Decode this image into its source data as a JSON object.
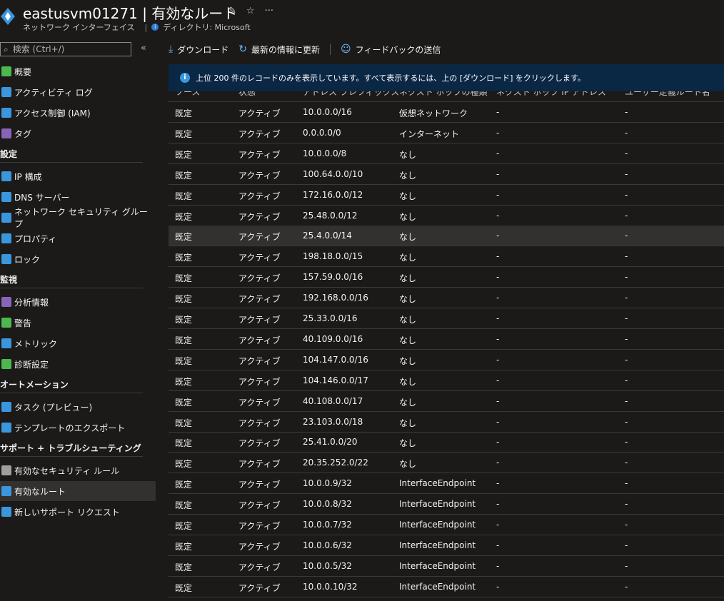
{
  "header": {
    "title": "eastusvm01271 | 有効なルート",
    "subtitle": "ネットワーク インターフェイス",
    "directory": "ディレクトリ: Microsoft",
    "actions": [
      "✩",
      "☆",
      "···"
    ]
  },
  "sidebar": {
    "search_placeholder": "検索 (Ctrl+/)",
    "collapse": "«",
    "items": [
      {
        "label": "概要",
        "icon": "overview-icon",
        "color": "#4db84d"
      },
      {
        "label": "アクティビティ ログ",
        "icon": "activity-log-icon",
        "color": "#3a96dd"
      },
      {
        "label": "アクセス制御 (IAM)",
        "icon": "iam-icon",
        "color": "#3a96dd"
      },
      {
        "label": "タグ",
        "icon": "tag-icon",
        "color": "#8764b8"
      }
    ],
    "sections": [
      {
        "title": "設定",
        "items": [
          {
            "label": "IP 構成",
            "icon": "ip-config-icon",
            "color": "#3a96dd"
          },
          {
            "label": "DNS サーバー",
            "icon": "dns-icon",
            "color": "#3a96dd"
          },
          {
            "label": "ネットワーク セキュリティ グループ",
            "icon": "nsg-icon",
            "color": "#3a96dd"
          },
          {
            "label": "プロパティ",
            "icon": "properties-icon",
            "color": "#3a96dd"
          },
          {
            "label": "ロック",
            "icon": "lock-icon",
            "color": "#3a96dd"
          }
        ]
      },
      {
        "title": "監視",
        "items": [
          {
            "label": "分析情報",
            "icon": "insights-icon",
            "color": "#8764b8"
          },
          {
            "label": "警告",
            "icon": "alerts-icon",
            "color": "#4db84d"
          },
          {
            "label": "メトリック",
            "icon": "metrics-icon",
            "color": "#3a96dd"
          },
          {
            "label": "診断設定",
            "icon": "diagnostics-icon",
            "color": "#4db84d"
          }
        ]
      },
      {
        "title": "オートメーション",
        "items": [
          {
            "label": "タスク (プレビュー)",
            "icon": "tasks-icon",
            "color": "#3a96dd"
          },
          {
            "label": "テンプレートのエクスポート",
            "icon": "export-template-icon",
            "color": "#3a96dd"
          }
        ]
      },
      {
        "title": "サポート + トラブルシューティング",
        "items": [
          {
            "label": "有効なセキュリティ ルール",
            "icon": "security-rules-icon",
            "color": "#a19f9d"
          },
          {
            "label": "有効なルート",
            "icon": "routes-icon",
            "color": "#3a96dd",
            "active": true
          },
          {
            "label": "新しいサポート リクエスト",
            "icon": "support-icon",
            "color": "#3a96dd"
          }
        ]
      }
    ]
  },
  "toolbar": {
    "download": "ダウンロード",
    "refresh": "最新の情報に更新",
    "feedback": "フィードバックの送信"
  },
  "banner": {
    "text": "上位 200 件のレコードのみを表示しています。すべて表示するには、上の [ダウンロード] をクリックします。"
  },
  "table": {
    "headers": [
      "ソース",
      "状態",
      "アドレス プレフィックス",
      "ネクスト ホップの種類",
      "ネクスト ホップ IP アドレス",
      "ユーザー定義ルート名"
    ],
    "rows": [
      [
        "既定",
        "アクティブ",
        "10.0.0.0/16",
        "仮想ネットワーク",
        "-",
        "-"
      ],
      [
        "既定",
        "アクティブ",
        "0.0.0.0/0",
        "インターネット",
        "-",
        "-"
      ],
      [
        "既定",
        "アクティブ",
        "10.0.0.0/8",
        "なし",
        "-",
        "-"
      ],
      [
        "既定",
        "アクティブ",
        "100.64.0.0/10",
        "なし",
        "-",
        "-"
      ],
      [
        "既定",
        "アクティブ",
        "172.16.0.0/12",
        "なし",
        "-",
        "-"
      ],
      [
        "既定",
        "アクティブ",
        "25.48.0.0/12",
        "なし",
        "-",
        "-"
      ],
      [
        "既定",
        "アクティブ",
        "25.4.0.0/14",
        "なし",
        "-",
        "-"
      ],
      [
        "既定",
        "アクティブ",
        "198.18.0.0/15",
        "なし",
        "-",
        "-"
      ],
      [
        "既定",
        "アクティブ",
        "157.59.0.0/16",
        "なし",
        "-",
        "-"
      ],
      [
        "既定",
        "アクティブ",
        "192.168.0.0/16",
        "なし",
        "-",
        "-"
      ],
      [
        "既定",
        "アクティブ",
        "25.33.0.0/16",
        "なし",
        "-",
        "-"
      ],
      [
        "既定",
        "アクティブ",
        "40.109.0.0/16",
        "なし",
        "-",
        "-"
      ],
      [
        "既定",
        "アクティブ",
        "104.147.0.0/16",
        "なし",
        "-",
        "-"
      ],
      [
        "既定",
        "アクティブ",
        "104.146.0.0/17",
        "なし",
        "-",
        "-"
      ],
      [
        "既定",
        "アクティブ",
        "40.108.0.0/17",
        "なし",
        "-",
        "-"
      ],
      [
        "既定",
        "アクティブ",
        "23.103.0.0/18",
        "なし",
        "-",
        "-"
      ],
      [
        "既定",
        "アクティブ",
        "25.41.0.0/20",
        "なし",
        "-",
        "-"
      ],
      [
        "既定",
        "アクティブ",
        "20.35.252.0/22",
        "なし",
        "-",
        "-"
      ],
      [
        "既定",
        "アクティブ",
        "10.0.0.9/32",
        "InterfaceEndpoint",
        "-",
        "-"
      ],
      [
        "既定",
        "アクティブ",
        "10.0.0.8/32",
        "InterfaceEndpoint",
        "-",
        "-"
      ],
      [
        "既定",
        "アクティブ",
        "10.0.0.7/32",
        "InterfaceEndpoint",
        "-",
        "-"
      ],
      [
        "既定",
        "アクティブ",
        "10.0.0.6/32",
        "InterfaceEndpoint",
        "-",
        "-"
      ],
      [
        "既定",
        "アクティブ",
        "10.0.0.5/32",
        "InterfaceEndpoint",
        "-",
        "-"
      ],
      [
        "既定",
        "アクティブ",
        "10.0.0.10/32",
        "InterfaceEndpoint",
        "-",
        "-"
      ]
    ],
    "highlighted_row": 6
  }
}
